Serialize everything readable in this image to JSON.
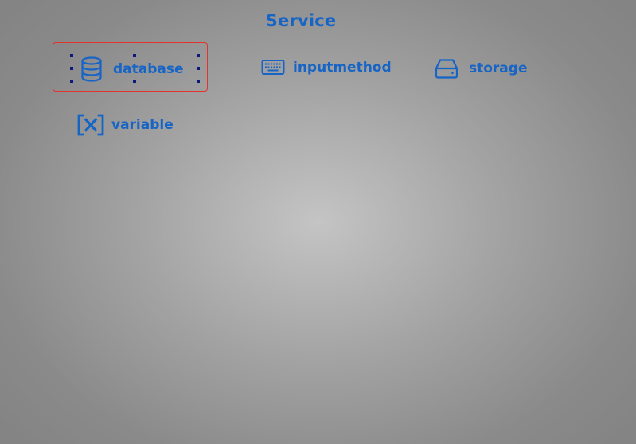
{
  "page": {
    "title": "Service"
  },
  "colors": {
    "accent": "#1664c6",
    "selection_border": "#e0342c",
    "selection_handle": "#0b1a7a"
  },
  "items": [
    {
      "label": "database",
      "icon": "database-icon",
      "selected": true
    },
    {
      "label": "inputmethod",
      "icon": "keyboard-icon",
      "selected": false
    },
    {
      "label": "storage",
      "icon": "hard-drive-icon",
      "selected": false
    },
    {
      "label": "variable",
      "icon": "variable-icon",
      "selected": false
    }
  ]
}
